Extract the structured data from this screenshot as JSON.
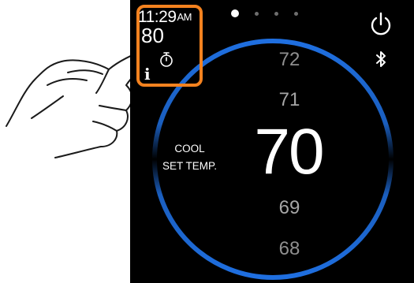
{
  "status": {
    "time": "11:29",
    "ampm": "AM",
    "indoor_temp": "80"
  },
  "pager": {
    "pages": 4,
    "active": 0
  },
  "mode": {
    "line1": "COOL",
    "line2": "SET TEMP."
  },
  "temperatures": {
    "above2": "72",
    "above1": "71",
    "current": "70",
    "below1": "69",
    "below2": "68"
  },
  "colors": {
    "highlight_box": "#f4821f",
    "dial_arc": "#1f6fe0",
    "screen_bg": "#000000"
  },
  "icons": {
    "power": "power-icon",
    "bluetooth": "bluetooth-icon",
    "timer": "timer-icon",
    "info": "info-icon"
  }
}
